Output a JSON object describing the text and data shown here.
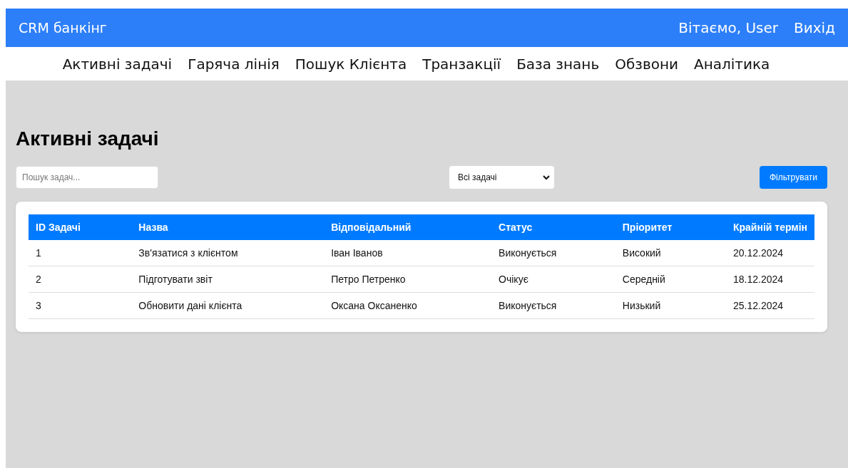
{
  "header": {
    "brand": "CRM банкінг",
    "greeting": "Вітаємо, User",
    "logout": "Вихід"
  },
  "nav": [
    "Активні задачі",
    "Гаряча лінія",
    "Пошук Клієнта",
    "Транзакції",
    "База знань",
    "Обзвони",
    "Аналітика"
  ],
  "page_title": "Активні задачі",
  "search": {
    "placeholder": "Пошук задач..."
  },
  "filter_select": {
    "value": "Всі задачі"
  },
  "filter_button": "Фільтрувати",
  "table": {
    "columns": [
      "ID Задачі",
      "Назва",
      "Відповідальний",
      "Статус",
      "Пріоритет",
      "Крайній термін"
    ],
    "rows": [
      [
        "1",
        "Зв'язатися з клієнтом",
        "Іван Іванов",
        "Виконується",
        "Високий",
        "20.12.2024"
      ],
      [
        "2",
        "Підготувати звіт",
        "Петро Петренко",
        "Очікує",
        "Середній",
        "18.12.2024"
      ],
      [
        "3",
        "Обновити дані клієнта",
        "Оксана Оксаненко",
        "Виконується",
        "Низький",
        "25.12.2024"
      ]
    ]
  }
}
